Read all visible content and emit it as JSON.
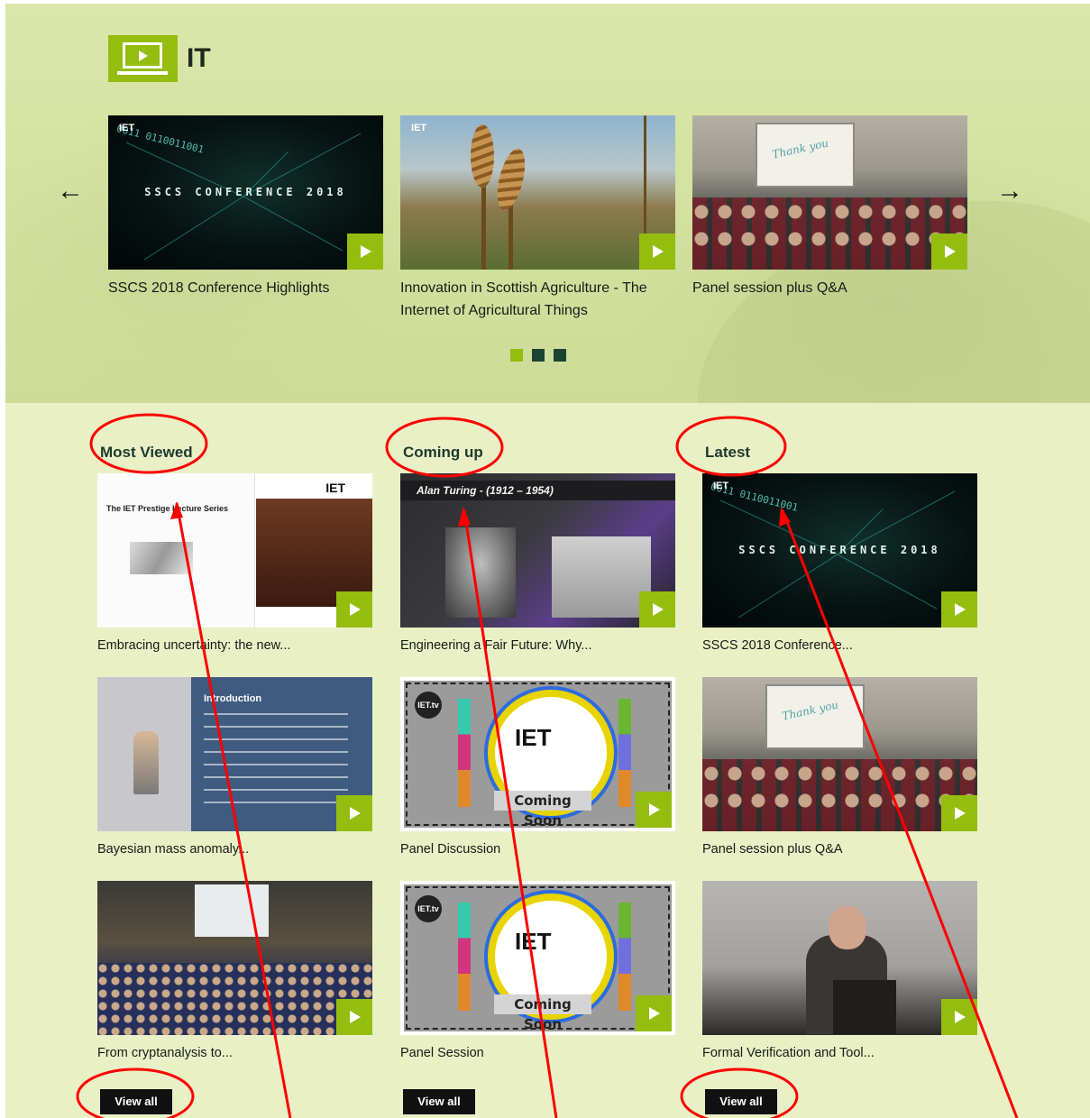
{
  "section": {
    "title": "IT",
    "icon": "monitor-play-icon",
    "accent": "#94bd10"
  },
  "carousel": {
    "prev_icon": "arrow-left-icon",
    "next_icon": "arrow-right-icon",
    "prev_label": "←",
    "next_label": "→",
    "items": [
      {
        "title": "SSCS 2018 Conference Highlights",
        "thumb_text": "SSCS CONFERENCE 2018"
      },
      {
        "title": "Innovation in Scottish Agriculture - The Internet of Agricultural Things"
      },
      {
        "title": "Panel session plus Q&A",
        "thumb_text": "Thank you"
      }
    ],
    "pages": 3,
    "active_page": 1
  },
  "columns": [
    {
      "heading": "Most Viewed",
      "view_all": "View all",
      "items": [
        {
          "title": "Embracing uncertainty: the new...",
          "thumb_text": "The IET Prestige Lecture Series"
        },
        {
          "title": "Bayesian mass anomaly...",
          "thumb_text": "Introduction"
        },
        {
          "title": "From cryptanalysis to..."
        }
      ]
    },
    {
      "heading": "Coming up",
      "view_all": "View all",
      "items": [
        {
          "title": "Engineering a Fair Future: Why...",
          "thumb_text": "Alan Turing - (1912 – 1954)"
        },
        {
          "title": "Panel Discussion",
          "thumb_text": "Coming Soon"
        },
        {
          "title": "Panel Session",
          "thumb_text": "Coming Soon"
        }
      ]
    },
    {
      "heading": "Latest",
      "view_all": "View all",
      "items": [
        {
          "title": "SSCS 2018 Conference...",
          "thumb_text": "SSCS CONFERENCE 2018"
        },
        {
          "title": "Panel session plus Q&A",
          "thumb_text": "Thank you"
        },
        {
          "title": "Formal Verification and Tool..."
        }
      ]
    }
  ],
  "logo_text": "IET",
  "annotation_color": "#ff0000"
}
